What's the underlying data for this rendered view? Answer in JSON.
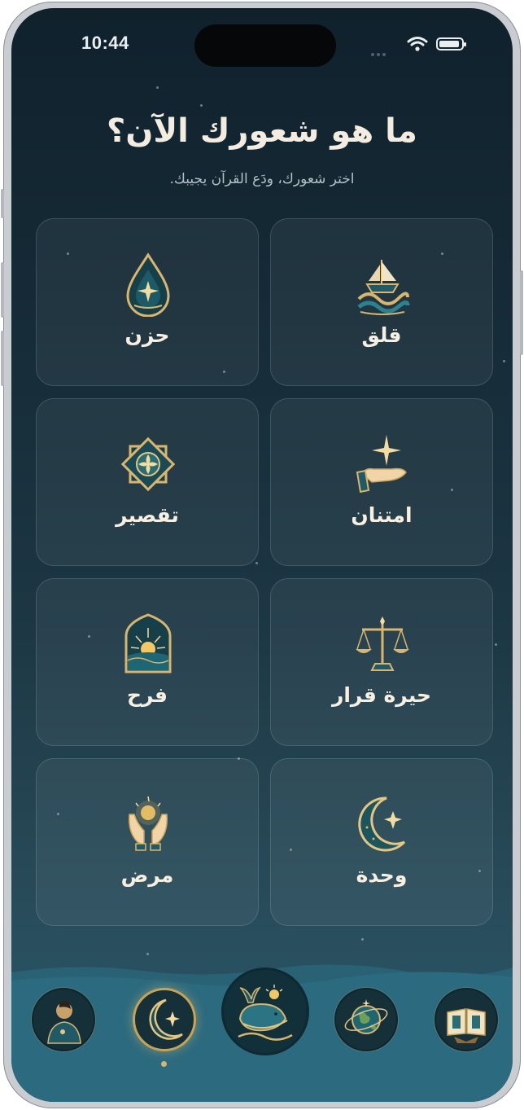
{
  "status_bar": {
    "time": "10:44"
  },
  "header": {
    "title": "ما هو شعورك الآن؟",
    "subtitle": "اختر شعورك، ودَع القرآن يجيبك."
  },
  "moods": [
    {
      "label": "قلق",
      "icon": "ship-waves-icon"
    },
    {
      "label": "حزن",
      "icon": "teardrop-icon"
    },
    {
      "label": "امتنان",
      "icon": "hand-star-icon"
    },
    {
      "label": "تقصير",
      "icon": "geometric-flower-icon"
    },
    {
      "label": "حيرة قرار",
      "icon": "scales-icon"
    },
    {
      "label": "فرح",
      "icon": "sunrise-arch-icon"
    },
    {
      "label": "وحدة",
      "icon": "crescent-star-icon"
    },
    {
      "label": "مرض",
      "icon": "praying-hands-icon"
    }
  ],
  "bottom_nav": [
    {
      "icon": "person-icon",
      "active": false
    },
    {
      "icon": "crescent-star-icon",
      "active": true
    },
    {
      "icon": "whale-icon",
      "active": false
    },
    {
      "icon": "globe-icon",
      "active": false
    },
    {
      "icon": "quran-book-icon",
      "active": false
    }
  ],
  "colors": {
    "background_top": "#10212c",
    "background_bottom": "#2b5a6c",
    "gold": "#d9b56d",
    "teal": "#1f5a66",
    "text": "#f6efe2"
  }
}
